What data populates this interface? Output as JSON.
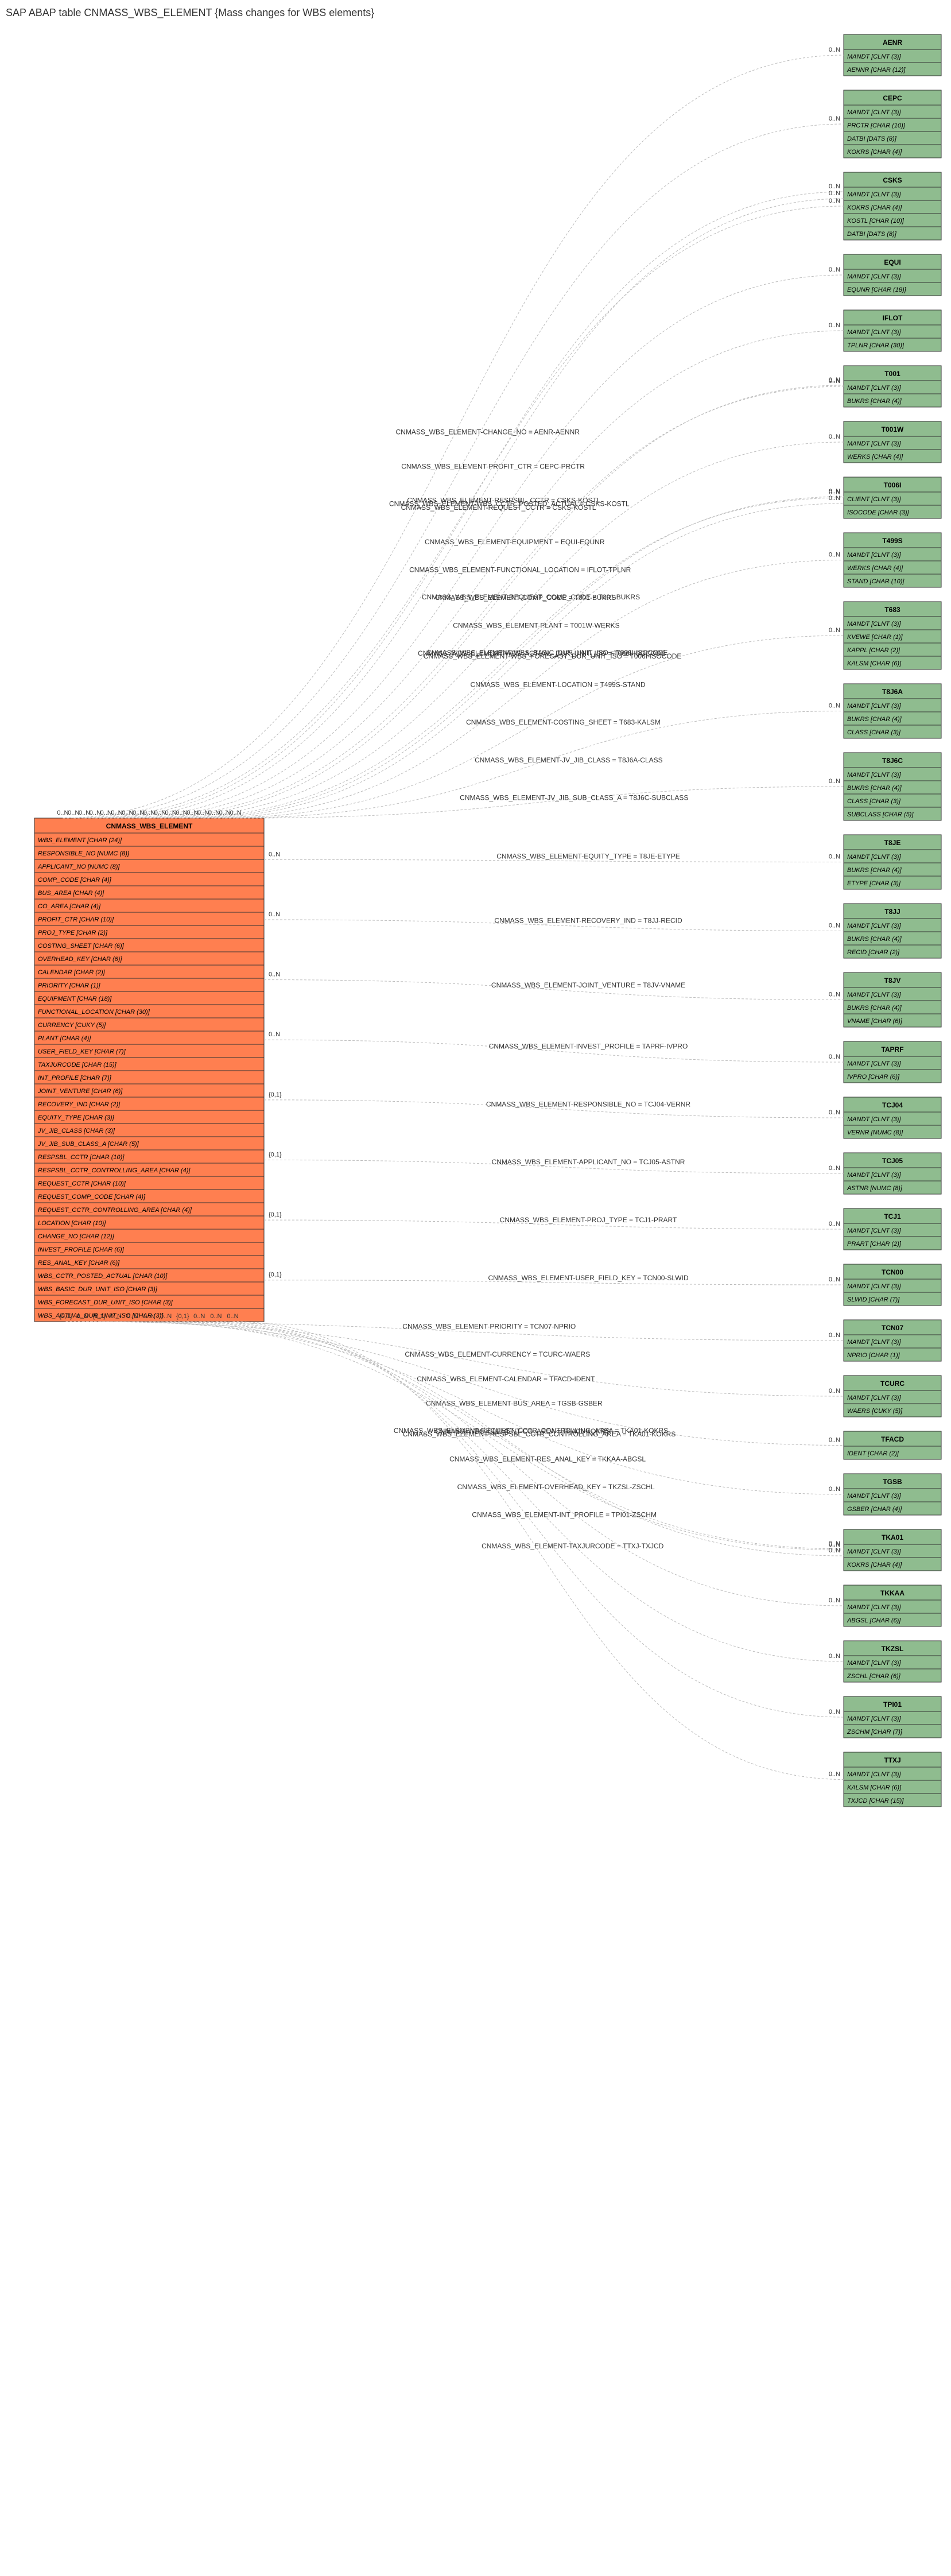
{
  "title": "SAP ABAP table CNMASS_WBS_ELEMENT {Mass changes for WBS elements}",
  "main_table": {
    "name": "CNMASS_WBS_ELEMENT",
    "fields": [
      "WBS_ELEMENT [CHAR (24)]",
      "RESPONSIBLE_NO [NUMC (8)]",
      "APPLICANT_NO [NUMC (8)]",
      "COMP_CODE [CHAR (4)]",
      "BUS_AREA [CHAR (4)]",
      "CO_AREA [CHAR (4)]",
      "PROFIT_CTR [CHAR (10)]",
      "PROJ_TYPE [CHAR (2)]",
      "COSTING_SHEET [CHAR (6)]",
      "OVERHEAD_KEY [CHAR (6)]",
      "CALENDAR [CHAR (2)]",
      "PRIORITY [CHAR (1)]",
      "EQUIPMENT [CHAR (18)]",
      "FUNCTIONAL_LOCATION [CHAR (30)]",
      "CURRENCY [CUKY (5)]",
      "PLANT [CHAR (4)]",
      "USER_FIELD_KEY [CHAR (7)]",
      "TAXJURCODE [CHAR (15)]",
      "INT_PROFILE [CHAR (7)]",
      "JOINT_VENTURE [CHAR (6)]",
      "RECOVERY_IND [CHAR (2)]",
      "EQUITY_TYPE [CHAR (3)]",
      "JV_JIB_CLASS [CHAR (3)]",
      "JV_JIB_SUB_CLASS_A [CHAR (5)]",
      "RESPSBL_CCTR [CHAR (10)]",
      "RESPSBL_CCTR_CONTROLLING_AREA [CHAR (4)]",
      "REQUEST_CCTR [CHAR (10)]",
      "REQUEST_COMP_CODE [CHAR (4)]",
      "REQUEST_CCTR_CONTROLLING_AREA [CHAR (4)]",
      "LOCATION [CHAR (10)]",
      "CHANGE_NO [CHAR (12)]",
      "INVEST_PROFILE [CHAR (6)]",
      "RES_ANAL_KEY [CHAR (6)]",
      "WBS_CCTR_POSTED_ACTUAL [CHAR (10)]",
      "WBS_BASIC_DUR_UNIT_ISO [CHAR (3)]",
      "WBS_FORECAST_DUR_UNIT_ISO [CHAR (3)]",
      "WBS_ACTUAL_DUR_UNIT_ISO [CHAR (3)]"
    ]
  },
  "relations": [
    {
      "label": "CNMASS_WBS_ELEMENT-CHANGE_NO = AENR-AENNR",
      "left_card": "0..N",
      "right_card": "0..N",
      "target": {
        "name": "AENR",
        "rows": [
          "MANDT [CLNT (3)]",
          "AENNR [CHAR (12)]"
        ]
      }
    },
    {
      "label": "CNMASS_WBS_ELEMENT-PROFIT_CTR = CEPC-PRCTR",
      "left_card": "0..N",
      "right_card": "0..N",
      "target": {
        "name": "CEPC",
        "rows": [
          "MANDT [CLNT (3)]",
          "PRCTR [CHAR (10)]",
          "DATBI [DATS (8)]",
          "KOKRS [CHAR (4)]"
        ]
      }
    },
    {
      "label": "CNMASS_WBS_ELEMENT-REQUEST_CCTR = CSKS-KOSTL",
      "left_card": "0..N",
      "right_card": "0..N",
      "target": {
        "name": "CSKS",
        "rows": [
          "MANDT [CLNT (3)]",
          "KOKRS [CHAR (4)]",
          "KOSTL [CHAR (10)]",
          "DATBI [DATS (8)]"
        ]
      }
    },
    {
      "label": "CNMASS_WBS_ELEMENT-RESPSBL_CCTR = CSKS-KOSTL",
      "left_card": "0..N",
      "right_card": "0..N",
      "target": null
    },
    {
      "label": "CNMASS_WBS_ELEMENT-WBS_CCTR_POSTED_ACTUAL = CSKS-KOSTL",
      "left_card": "0..N",
      "right_card": "0..N",
      "target": null
    },
    {
      "label": "CNMASS_WBS_ELEMENT-EQUIPMENT = EQUI-EQUNR",
      "left_card": "0..N",
      "right_card": "0..N",
      "target": {
        "name": "EQUI",
        "rows": [
          "MANDT [CLNT (3)]",
          "EQUNR [CHAR (18)]"
        ]
      }
    },
    {
      "label": "CNMASS_WBS_ELEMENT-FUNCTIONAL_LOCATION = IFLOT-TPLNR",
      "left_card": "0..N",
      "right_card": "0..N",
      "target": {
        "name": "IFLOT",
        "rows": [
          "MANDT [CLNT (3)]",
          "TPLNR [CHAR (30)]"
        ]
      }
    },
    {
      "label": "CNMASS_WBS_ELEMENT-COMP_CODE = T001-BUKRS",
      "left_card": "0..N",
      "right_card": "0..N",
      "target": {
        "name": "T001",
        "rows": [
          "MANDT [CLNT (3)]",
          "BUKRS [CHAR (4)]"
        ]
      }
    },
    {
      "label": "CNMASS_WBS_ELEMENT-REQUEST_COMP_CODE = T001-BUKRS",
      "left_card": "0..N",
      "right_card": "0..N",
      "target": null
    },
    {
      "label": "CNMASS_WBS_ELEMENT-PLANT = T001W-WERKS",
      "left_card": "0..N",
      "right_card": "0..N",
      "target": {
        "name": "T001W",
        "rows": [
          "MANDT [CLNT (3)]",
          "WERKS [CHAR (4)]"
        ]
      }
    },
    {
      "label": "CNMASS_WBS_ELEMENT-WBS_ACTUAL_DUR_UNIT_ISO = T006I-ISOCODE",
      "left_card": "0..N",
      "right_card": "0..N",
      "target": {
        "name": "T006I",
        "rows": [
          "CLIENT [CLNT (3)]",
          "ISOCODE [CHAR (3)]"
        ]
      }
    },
    {
      "label": "CNMASS_WBS_ELEMENT-WBS_BASIC_DUR_UNIT_ISO = T006I-ISOCODE",
      "left_card": "0..N",
      "right_card": "0..N",
      "target": null
    },
    {
      "label": "CNMASS_WBS_ELEMENT-WBS_FORECAST_DUR_UNIT_ISO = T006I-ISOCODE",
      "left_card": "0..N",
      "right_card": "0..N",
      "target": null
    },
    {
      "label": "CNMASS_WBS_ELEMENT-LOCATION = T499S-STAND",
      "left_card": "0..N",
      "right_card": "0..N",
      "target": {
        "name": "T499S",
        "rows": [
          "MANDT [CLNT (3)]",
          "WERKS [CHAR (4)]",
          "STAND [CHAR (10)]"
        ]
      }
    },
    {
      "label": "CNMASS_WBS_ELEMENT-COSTING_SHEET = T683-KALSM",
      "left_card": "0..N",
      "right_card": "0..N",
      "target": {
        "name": "T683",
        "rows": [
          "MANDT [CLNT (3)]",
          "KVEWE [CHAR (1)]",
          "KAPPL [CHAR (2)]",
          "KALSM [CHAR (6)]"
        ]
      }
    },
    {
      "label": "CNMASS_WBS_ELEMENT-JV_JIB_CLASS = T8J6A-CLASS",
      "left_card": "0..N",
      "right_card": "0..N",
      "target": {
        "name": "T8J6A",
        "rows": [
          "MANDT [CLNT (3)]",
          "BUKRS [CHAR (4)]",
          "CLASS [CHAR (3)]"
        ]
      }
    },
    {
      "label": "CNMASS_WBS_ELEMENT-JV_JIB_SUB_CLASS_A = T8J6C-SUBCLASS",
      "left_card": "0..N",
      "right_card": "0..N",
      "target": {
        "name": "T8J6C",
        "rows": [
          "MANDT [CLNT (3)]",
          "BUKRS [CHAR (4)]",
          "CLASS [CHAR (3)]",
          "SUBCLASS [CHAR (5)]"
        ]
      }
    },
    {
      "label": "CNMASS_WBS_ELEMENT-EQUITY_TYPE = T8JE-ETYPE",
      "left_card": "0..N",
      "right_card": "0..N",
      "target": {
        "name": "T8JE",
        "rows": [
          "MANDT [CLNT (3)]",
          "BUKRS [CHAR (4)]",
          "ETYPE [CHAR (3)]"
        ]
      }
    },
    {
      "label": "CNMASS_WBS_ELEMENT-RECOVERY_IND = T8JJ-RECID",
      "left_card": "0..N",
      "right_card": "0..N",
      "target": {
        "name": "T8JJ",
        "rows": [
          "MANDT [CLNT (3)]",
          "BUKRS [CHAR (4)]",
          "RECID [CHAR (2)]"
        ]
      }
    },
    {
      "label": "CNMASS_WBS_ELEMENT-JOINT_VENTURE = T8JV-VNAME",
      "left_card": "0..N",
      "right_card": "0..N",
      "target": {
        "name": "T8JV",
        "rows": [
          "MANDT [CLNT (3)]",
          "BUKRS [CHAR (4)]",
          "VNAME [CHAR (6)]"
        ]
      }
    },
    {
      "label": "CNMASS_WBS_ELEMENT-INVEST_PROFILE = TAPRF-IVPRO",
      "left_card": "0..N",
      "right_card": "0..N",
      "target": {
        "name": "TAPRF",
        "rows": [
          "MANDT [CLNT (3)]",
          "IVPRO [CHAR (6)]"
        ]
      }
    },
    {
      "label": "CNMASS_WBS_ELEMENT-RESPONSIBLE_NO = TCJ04-VERNR",
      "left_card": "{0,1}",
      "right_card": "0..N",
      "target": {
        "name": "TCJ04",
        "rows": [
          "MANDT [CLNT (3)]",
          "VERNR [NUMC (8)]"
        ]
      }
    },
    {
      "label": "CNMASS_WBS_ELEMENT-APPLICANT_NO = TCJ05-ASTNR",
      "left_card": "{0,1}",
      "right_card": "0..N",
      "target": {
        "name": "TCJ05",
        "rows": [
          "MANDT [CLNT (3)]",
          "ASTNR [NUMC (8)]"
        ]
      }
    },
    {
      "label": "CNMASS_WBS_ELEMENT-PROJ_TYPE = TCJ1-PRART",
      "left_card": "{0,1}",
      "right_card": "0..N",
      "target": {
        "name": "TCJ1",
        "rows": [
          "MANDT [CLNT (3)]",
          "PRART [CHAR (2)]"
        ]
      }
    },
    {
      "label": "CNMASS_WBS_ELEMENT-USER_FIELD_KEY = TCN00-SLWID",
      "left_card": "{0,1}",
      "right_card": "0..N",
      "target": {
        "name": "TCN00",
        "rows": [
          "MANDT [CLNT (3)]",
          "SLWID [CHAR (7)]"
        ]
      }
    },
    {
      "label": "CNMASS_WBS_ELEMENT-PRIORITY = TCN07-NPRIO",
      "left_card": "{0,1}",
      "right_card": "0..N",
      "target": {
        "name": "TCN07",
        "rows": [
          "MANDT [CLNT (3)]",
          "NPRIO [CHAR (1)]"
        ]
      }
    },
    {
      "label": "CNMASS_WBS_ELEMENT-CURRENCY = TCURC-WAERS",
      "left_card": "0..N",
      "right_card": "0..N",
      "target": {
        "name": "TCURC",
        "rows": [
          "MANDT [CLNT (3)]",
          "WAERS [CUKY (5)]"
        ]
      }
    },
    {
      "label": "CNMASS_WBS_ELEMENT-CALENDAR = TFACD-IDENT",
      "left_card": "{0,1}",
      "right_card": "0..N",
      "target": {
        "name": "TFACD",
        "rows": [
          "IDENT [CHAR (2)]"
        ]
      }
    },
    {
      "label": "CNMASS_WBS_ELEMENT-BUS_AREA = TGSB-GSBER",
      "left_card": "0..N",
      "right_card": "0..N",
      "target": {
        "name": "TGSB",
        "rows": [
          "MANDT [CLNT (3)]",
          "GSBER [CHAR (4)]"
        ]
      }
    },
    {
      "label": "CNMASS_WBS_ELEMENT-CO_AREA = TKA01-KOKRS",
      "left_card": "0..N",
      "right_card": "0..N",
      "target": {
        "name": "TKA01",
        "rows": [
          "MANDT [CLNT (3)]",
          "KOKRS [CHAR (4)]"
        ]
      }
    },
    {
      "label": "CNMASS_WBS_ELEMENT-REQUEST_CCTR_CONTROLLING_AREA = TKA01-KOKRS",
      "left_card": "0..N",
      "right_card": "0..N",
      "target": null
    },
    {
      "label": "CNMASS_WBS_ELEMENT-RESPSBL_CCTR_CONTROLLING_AREA = TKA01-KOKRS",
      "left_card": "0..N",
      "right_card": "0..N",
      "target": null
    },
    {
      "label": "CNMASS_WBS_ELEMENT-RES_ANAL_KEY = TKKAA-ABGSL",
      "left_card": "{0,1}",
      "right_card": "0..N",
      "target": {
        "name": "TKKAA",
        "rows": [
          "MANDT [CLNT (3)]",
          "ABGSL [CHAR (6)]"
        ]
      }
    },
    {
      "label": "CNMASS_WBS_ELEMENT-OVERHEAD_KEY = TKZSL-ZSCHL",
      "left_card": "0..N",
      "right_card": "0..N",
      "target": {
        "name": "TKZSL",
        "rows": [
          "MANDT [CLNT (3)]",
          "ZSCHL [CHAR (6)]"
        ]
      }
    },
    {
      "label": "CNMASS_WBS_ELEMENT-INT_PROFILE = TPI01-ZSCHM",
      "left_card": "0..N",
      "right_card": "0..N",
      "target": {
        "name": "TPI01",
        "rows": [
          "MANDT [CLNT (3)]",
          "ZSCHM [CHAR (7)]"
        ]
      }
    },
    {
      "label": "CNMASS_WBS_ELEMENT-TAXJURCODE = TTXJ-TXJCD",
      "left_card": "0..N",
      "right_card": "0..N",
      "target": {
        "name": "TTXJ",
        "rows": [
          "MANDT [CLNT (3)]",
          "KALSM [CHAR (6)]",
          "TXJCD [CHAR (15)]"
        ]
      }
    }
  ]
}
